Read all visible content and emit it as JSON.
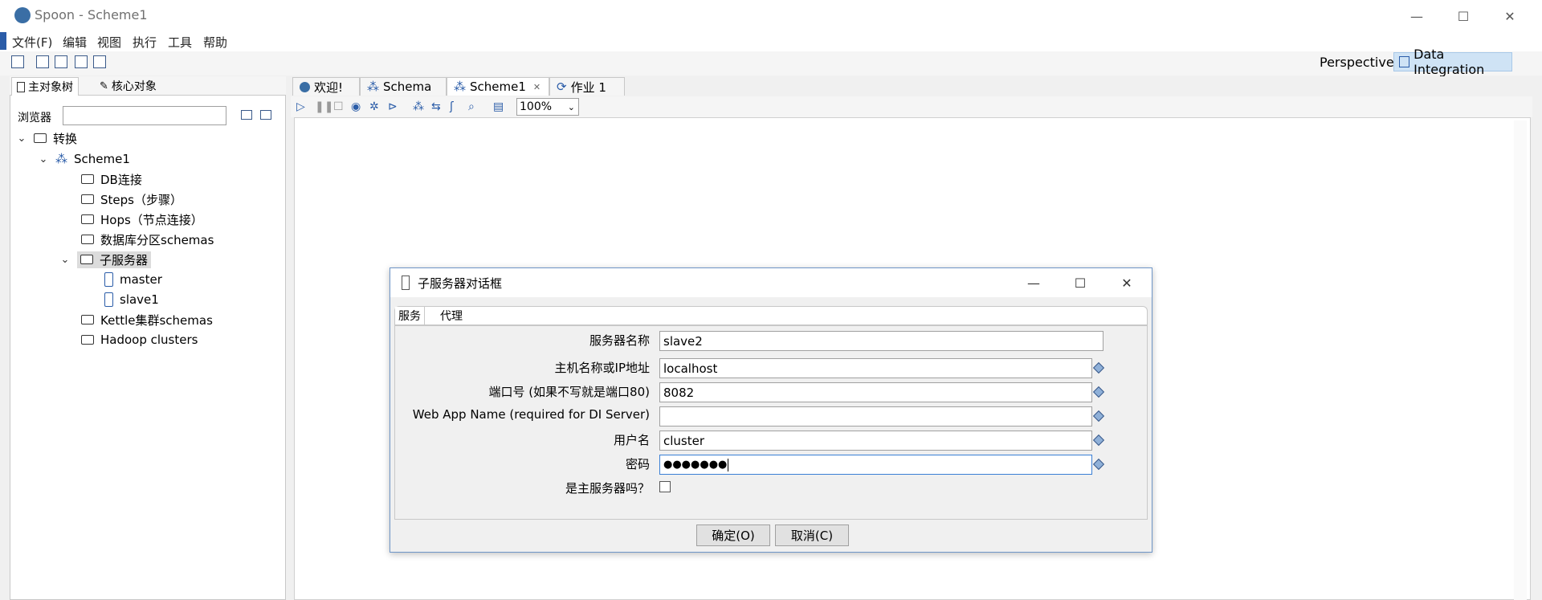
{
  "window": {
    "title": "Spoon - Scheme1",
    "minimize": "—",
    "maximize": "☐",
    "close": "✕"
  },
  "menu": [
    "文件(F)",
    "编辑",
    "视图",
    "执行",
    "工具",
    "帮助"
  ],
  "perspective": {
    "label": "Perspective:",
    "value": "Data Integration"
  },
  "left_panel": {
    "tabs": [
      "主对象树",
      "核心对象"
    ],
    "browser_label": "浏览器",
    "browser_value": "",
    "tree": {
      "root": "转换",
      "scheme": "Scheme1",
      "items": [
        "DB连接",
        "Steps（步骤）",
        "Hops（节点连接）",
        "数据库分区schemas",
        "子服务器",
        "Kettle集群schemas",
        "Hadoop clusters"
      ],
      "servers": [
        "master",
        "slave1"
      ]
    }
  },
  "editor_tabs": [
    "欢迎!",
    "Schema",
    "Scheme1",
    "作业 1"
  ],
  "zoom": "100%",
  "dialog": {
    "title": "子服务器对话框",
    "tabs": [
      "服务",
      "代理"
    ],
    "fields": {
      "server_name": {
        "label": "服务器名称",
        "value": "slave2"
      },
      "host": {
        "label": "主机名称或IP地址",
        "value": "localhost"
      },
      "port": {
        "label": "端口号 (如果不写就是端口80)",
        "value": "8082"
      },
      "webapp": {
        "label": "Web App Name (required for DI Server)",
        "value": ""
      },
      "user": {
        "label": "用户名",
        "value": "cluster"
      },
      "password": {
        "label": "密码",
        "value": "●●●●●●●"
      },
      "is_master": {
        "label": "是主服务器吗？",
        "checked": false
      }
    },
    "ok_label": "确定(O)",
    "cancel_label": "取消(C)"
  }
}
